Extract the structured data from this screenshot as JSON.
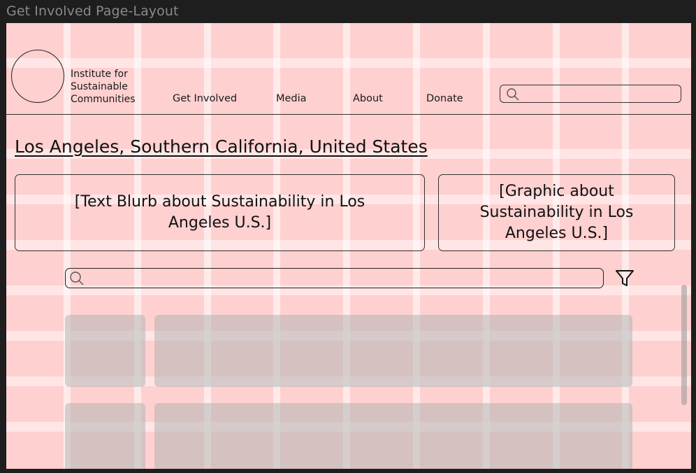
{
  "window": {
    "frame_title": "Get Involved Page-Layout"
  },
  "header": {
    "logo_lines": [
      "Institute for",
      "Sustainable",
      "Communities"
    ],
    "nav": [
      "Get Involved",
      "Media",
      "About",
      "Donate"
    ],
    "search_icon": "search-icon"
  },
  "main": {
    "heading": "Los Angeles, Southern California, United States",
    "blurb_text": "[Text Blurb about Sustainability in Los Angeles U.S.]",
    "graphic_text": "[Graphic about Sustainability in Los Angeles U.S.]",
    "search_icon": "search-icon",
    "filter_icon": "filter-icon"
  },
  "colors": {
    "canvas": "#1e1e1e",
    "frame_bg": "#ffd0d0",
    "placeholder_card": "#b4b4b4",
    "stroke": "#222222"
  }
}
